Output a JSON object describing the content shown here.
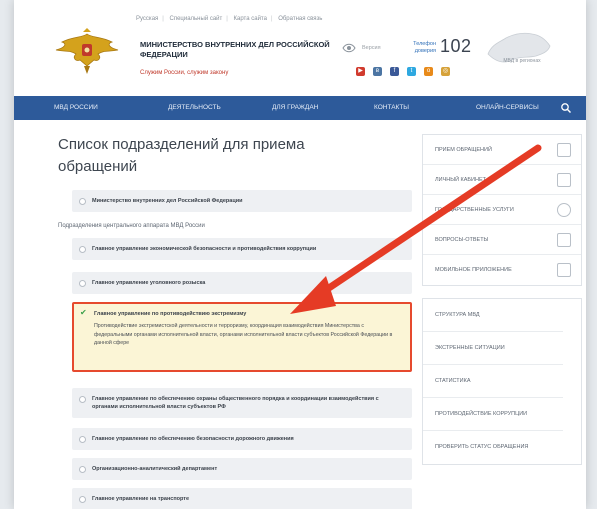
{
  "top_links": [
    "Русская",
    "Специальный сайт",
    "Карта сайта",
    "Обратная связь"
  ],
  "ministry": {
    "title": "Министерство внутренних дел Российской Федерации",
    "subtitle": "Служим России, служим закону"
  },
  "header": {
    "version_label": "Версия",
    "hotline_label": "Телефон доверия",
    "hotline_number": "102",
    "map_label": "МВД в регионах"
  },
  "nav": {
    "items": [
      "МВД России",
      "Деятельность",
      "Для граждан",
      "Контакты",
      "Онлайн-сервисы"
    ]
  },
  "main": {
    "page_title": "Список подразделений для приема обращений",
    "top_item": "Министерство внутренних дел Российской Федерации",
    "section_label": "Подразделения центрального аппарата МВД России",
    "items": [
      {
        "name": "Главное управление экономической безопасности и противодействия коррупции"
      },
      {
        "name": "Главное управление уголовного розыска"
      },
      {
        "name": "Главное управление по противодействию экстремизму",
        "desc": "Противодействие экстремистской деятельности и терроризму, координация взаимодействия Министерства с федеральными органами исполнительной власти, органами исполнительной власти субъектов Российской Федерации в данной сфере"
      },
      {
        "name": "Главное управление по обеспечению охраны общественного порядка и координации взаимодействия с органами исполнительной власти субъектов РФ"
      },
      {
        "name": "Главное управление по обеспечению безопасности дорожного движения"
      },
      {
        "name": "Организационно-аналитический департамент"
      },
      {
        "name": "Главное управление на транспорте"
      }
    ]
  },
  "sidebar": {
    "box1": [
      "Прием обращений",
      "Личный кабинет",
      "Государственные услуги",
      "Вопросы-ответы",
      "Мобильное приложение"
    ],
    "box2": [
      "Структура МВД",
      "Экстренные ситуации",
      "Статистика",
      "Противодействие коррупции",
      "Проверить статус обращения"
    ]
  },
  "colors": {
    "nav": "#2d5a9a",
    "highlight_border": "#e64a2e",
    "highlight_bg": "#fbf5d6",
    "arrow": "#e53b25"
  }
}
